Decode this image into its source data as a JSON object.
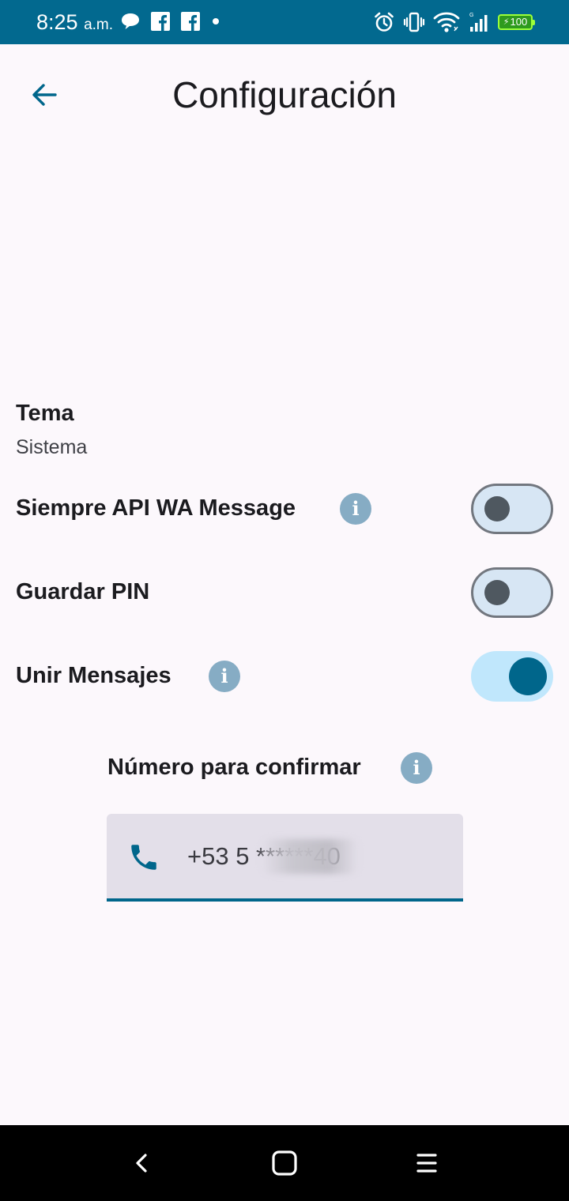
{
  "status_bar": {
    "time": "8:25",
    "ampm": "a.m.",
    "battery": "100"
  },
  "header": {
    "title": "Configuración"
  },
  "settings": {
    "theme": {
      "title": "Tema",
      "value": "Sistema"
    },
    "toggles": [
      {
        "label": "Siempre API WA Message",
        "on": false,
        "has_info": true
      },
      {
        "label": "Guardar PIN",
        "on": false,
        "has_info": false
      },
      {
        "label": "Unir Mensajes",
        "on": true,
        "has_info": true
      }
    ]
  },
  "confirm_number": {
    "label": "Número para confirmar",
    "value": "+53 5 ******40"
  },
  "colors": {
    "status_bar": "#02698f",
    "accent": "#00668b",
    "background": "#fcf8fc"
  }
}
